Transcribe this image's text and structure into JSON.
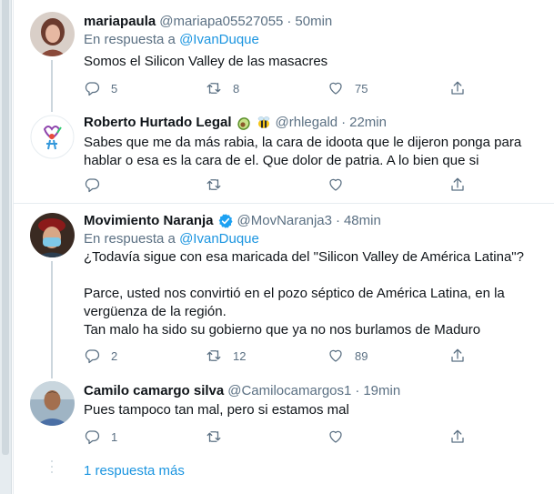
{
  "tweets": [
    {
      "name": "mariapaula",
      "handle": "@mariapa05527055",
      "separator": "·",
      "time": "50min",
      "reply_prefix": "En respuesta a",
      "reply_to": "@IvanDuque",
      "lines": [
        "Somos el Silicon Valley de las masacres"
      ],
      "replies": "5",
      "retweets": "8",
      "likes": "75"
    },
    {
      "name": "Roberto Hurtado Legal",
      "name_emojis": [
        "avocado-icon",
        "bee-icon"
      ],
      "handle": "@rhlegald",
      "separator": "·",
      "time": "22min",
      "lines": [
        "Sabes que me da más rabia, la cara de idoota que le dijeron ponga para",
        "hablar o esa es la cara de el. Que dolor de patria. A lo bien que si"
      ],
      "replies": "",
      "retweets": "",
      "likes": ""
    },
    {
      "name": "Movimiento Naranja",
      "handle": "@MovNaranja3",
      "separator": "·",
      "time": "48min",
      "reply_prefix": "En respuesta a",
      "reply_to": "@IvanDuque",
      "lines": [
        "¿Todavía sigue con esa maricada del \"Silicon Valley de América Latina\"?",
        "",
        "Parce, usted nos convirtió en el pozo séptico de América Latina, en la",
        "vergüenza de la región.",
        "Tan malo ha sido su gobierno que ya no nos burlamos de Maduro"
      ],
      "replies": "2",
      "retweets": "12",
      "likes": "89"
    },
    {
      "name": "Camilo camargo silva",
      "handle": "@Camilocamargos1",
      "separator": "·",
      "time": "19min",
      "lines": [
        "Pues tampoco tan mal, pero si estamos mal"
      ],
      "replies": "1",
      "retweets": "",
      "likes": ""
    }
  ],
  "more_replies": "1 respuesta más",
  "colors": {
    "accent": "#1b95e0",
    "secondary_text": "#5b7083",
    "border": "#e6ecf0",
    "verified": "#1da1f2"
  }
}
